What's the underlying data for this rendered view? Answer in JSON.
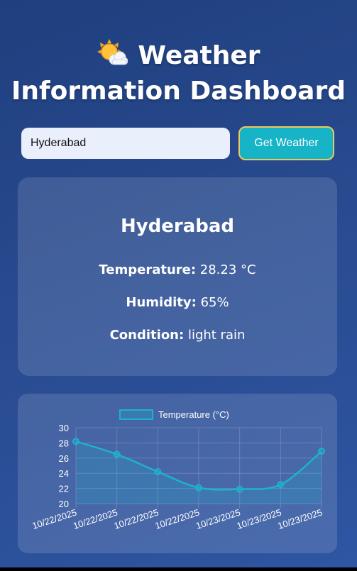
{
  "header": {
    "icon": "sun-behind-cloud-icon",
    "title_line1": "Weather",
    "title_line2": "Information Dashboard"
  },
  "search": {
    "value": "Hyderabad",
    "button_label": "Get Weather"
  },
  "weather": {
    "city": "Hyderabad",
    "temperature_label": "Temperature:",
    "temperature_value": "28.23 °C",
    "humidity_label": "Humidity:",
    "humidity_value": "65%",
    "condition_label": "Condition:",
    "condition_value": "light rain"
  },
  "colors": {
    "accent": "#17b3c6",
    "button_border": "#f0c85a",
    "line": "#1fb0cf"
  },
  "chart_data": {
    "type": "area",
    "x": [
      "10/22/2025",
      "10/22/2025",
      "10/22/2025",
      "10/22/2025",
      "10/23/2025",
      "10/23/2025",
      "10/23/2025"
    ],
    "series": [
      {
        "name": "Temperature (°C)",
        "values": [
          28.2,
          26.5,
          24.2,
          22.1,
          21.9,
          22.5,
          26.9
        ]
      }
    ],
    "ylim": [
      20,
      30
    ],
    "yticks": [
      20,
      22,
      24,
      26,
      28,
      30
    ],
    "legend": "top-center",
    "grid": true
  }
}
